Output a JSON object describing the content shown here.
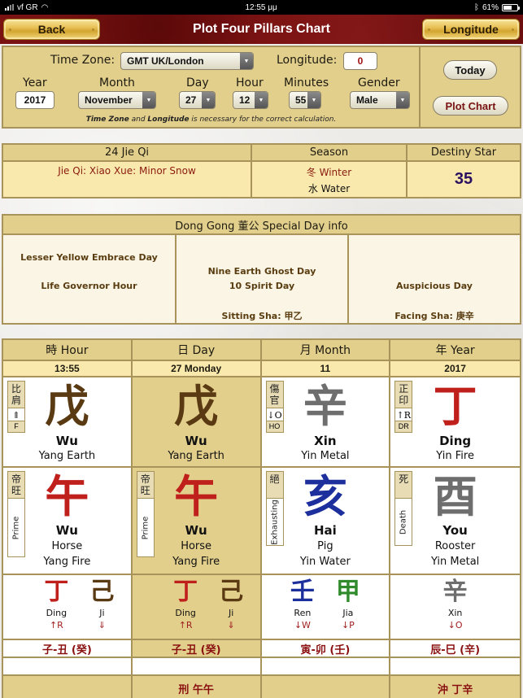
{
  "status_bar": {
    "carrier": "vf GR",
    "time": "12:55 μμ",
    "battery": "61%",
    "battery_level": 0.61
  },
  "nav": {
    "back_label": "Back",
    "title": "Plot Four Pillars Chart",
    "longitude_label": "Longitude"
  },
  "form": {
    "timezone_label": "Time Zone:",
    "timezone_value": "GMT UK/London",
    "longitude_label": "Longitude:",
    "longitude_value": "0",
    "year_label": "Year",
    "year_value": "2017",
    "month_label": "Month",
    "month_value": "November",
    "day_label": "Day",
    "day_value": "27",
    "hour_label": "Hour",
    "hour_value": "12",
    "minutes_label": "Minutes",
    "minutes_value": "55",
    "gender_label": "Gender",
    "gender_value": "Male",
    "note_part1": "Time Zone",
    "note_part2": " and ",
    "note_part3": "Longitude",
    "note_part4": " is necessary for the correct calculation.",
    "today_label": "Today",
    "plot_label": "Plot Chart"
  },
  "jieqi": {
    "head_jieqi": "24 Jie Qi",
    "head_season": "Season",
    "head_destiny": "Destiny Star",
    "jieqi_value": "Jie Qi: Xiao Xue: Minor Snow",
    "season_value": "冬 Winter",
    "element_value": "水 Water",
    "destiny_value": "35"
  },
  "donggong": {
    "title": "Dong Gong 董公 Special Day info",
    "col1_line1": "Lesser Yellow Embrace Day",
    "col1_line2": "Life Governor Hour",
    "col2_line1": "Nine Earth Ghost Day",
    "col2_line2": "10 Spirit Day",
    "col2_sha": "Sitting Sha: 甲乙",
    "col3_line1": "Auspicious Day",
    "col3_sha": "Facing Sha: 庚辛"
  },
  "pillars": [
    {
      "header": "時 Hour",
      "sub": "13:55",
      "stem": {
        "char": "戊",
        "color": "#5a3a12",
        "name": "Wu",
        "element": "Yang Earth",
        "badge_cn": "比肩",
        "badge_sym": "⇑",
        "badge_code": "F"
      },
      "branch": {
        "char": "午",
        "color": "#c0201c",
        "name": "Wu",
        "animal": "Horse",
        "element": "Yang Fire",
        "badge_cn": "帝旺",
        "badge_state": "Prime"
      },
      "hidden": [
        {
          "char": "丁",
          "color": "#c0201c",
          "name": "Ding",
          "rel": "↑R"
        },
        {
          "char": "己",
          "color": "#5a3a12",
          "name": "Ji",
          "rel": "⇓"
        }
      ],
      "void": "子-丑 (癸)",
      "blank": "",
      "clash": ""
    },
    {
      "header": "日 Day",
      "sub": "27 Monday",
      "stem": {
        "char": "戊",
        "color": "#5a3a12",
        "name": "Wu",
        "element": "Yang Earth"
      },
      "branch": {
        "char": "午",
        "color": "#c0201c",
        "name": "Wu",
        "animal": "Horse",
        "element": "Yang Fire",
        "badge_cn": "帝旺",
        "badge_state": "Prime"
      },
      "hidden": [
        {
          "char": "丁",
          "color": "#c0201c",
          "name": "Ding",
          "rel": "↑R"
        },
        {
          "char": "己",
          "color": "#5a3a12",
          "name": "Ji",
          "rel": "⇓"
        }
      ],
      "void": "子-丑 (癸)",
      "blank": "",
      "clash": "刑 午午"
    },
    {
      "header": "月 Month",
      "sub": "11",
      "stem": {
        "char": "辛",
        "color": "#6e6e6e",
        "name": "Xin",
        "element": "Yin Metal",
        "badge_cn": "傷官",
        "badge_sym": "↓O",
        "badge_code": "HO"
      },
      "branch": {
        "char": "亥",
        "color": "#1c2f9c",
        "name": "Hai",
        "animal": "Pig",
        "element": "Yin Water",
        "badge_cn": "絕",
        "badge_state": "Exhausting"
      },
      "hidden": [
        {
          "char": "壬",
          "color": "#1c2f9c",
          "name": "Ren",
          "rel": "↓W"
        },
        {
          "char": "甲",
          "color": "#2e8a2a",
          "name": "Jia",
          "rel": "↓P"
        }
      ],
      "void": "寅-卯 (壬)",
      "blank": "",
      "clash": ""
    },
    {
      "header": "年 Year",
      "sub": "2017",
      "stem": {
        "char": "丁",
        "color": "#c0201c",
        "name": "Ding",
        "element": "Yin Fire",
        "badge_cn": "正印",
        "badge_sym": "↑R",
        "badge_code": "DR"
      },
      "branch": {
        "char": "酉",
        "color": "#6e6e6e",
        "name": "You",
        "animal": "Rooster",
        "element": "Yin Metal",
        "badge_cn": "死",
        "badge_state": "Death"
      },
      "hidden": [
        {
          "char": "辛",
          "color": "#6e6e6e",
          "name": "Xin",
          "rel": "↓O"
        }
      ],
      "void": "辰-巳 (辛)",
      "blank": "",
      "clash": "沖 丁辛"
    }
  ]
}
